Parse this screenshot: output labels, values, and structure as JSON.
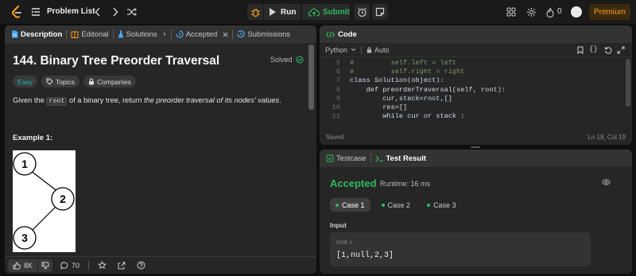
{
  "topbar": {
    "logo_icon": "leetcode-logo",
    "list_icon": "list-icon",
    "problem_list_label": "Problem List",
    "run_label": "Run",
    "submit_label": "Submit",
    "streak_count": "0",
    "premium_label": "Premium",
    "colors": {
      "submit_green": "#2cbb5d",
      "premium_orange": "#ffa116"
    }
  },
  "left_panel": {
    "tabs": [
      {
        "label": "Description",
        "icon": "document-icon"
      },
      {
        "label": "Editorial",
        "icon": "book-icon"
      },
      {
        "label": "Solutions",
        "icon": "flask-icon"
      },
      {
        "label": "Accepted",
        "icon": "clock-icon"
      },
      {
        "label": "Submissions",
        "icon": "history-icon"
      }
    ],
    "problem_title": "144. Binary Tree Preorder Traversal",
    "solved_label": "Solved",
    "tags": {
      "difficulty": "Easy",
      "topics": "Topics",
      "companies": "Companies"
    },
    "desc_prefix": "Given the ",
    "desc_code": "root",
    "desc_middle": " of a binary tree, return ",
    "desc_italic": "the preorder traversal of its nodes' values",
    "desc_suffix": ".",
    "example_heading": "Example 1:",
    "tree_nodes": [
      "1",
      "2",
      "3"
    ],
    "footer": {
      "likes": "8K",
      "comments": "70"
    }
  },
  "code_panel": {
    "title": "Code",
    "language": "Python",
    "auto_label": "Auto",
    "lines": [
      {
        "n": "5",
        "t": "#         self.left = left"
      },
      {
        "n": "6",
        "t": "#         self.right = right"
      },
      {
        "n": "7",
        "t": "class Solution(object):"
      },
      {
        "n": "8",
        "t": "    def preorderTraversal(self, root):"
      },
      {
        "n": "9",
        "t": "        cur,stack=root,[]"
      },
      {
        "n": "10",
        "t": "        res=[]"
      },
      {
        "n": "11",
        "t": "        while cur or stack :"
      }
    ],
    "status": "Saved",
    "cursor": "Ln 18, Col 19"
  },
  "result_panel": {
    "tab_testcase": "Testcase",
    "tab_result": "Test Result",
    "accepted": "Accepted",
    "runtime": "Runtime: 16 ms",
    "cases": [
      "Case 1",
      "Case 2",
      "Case 3"
    ],
    "input_label": "Input",
    "var_name": "root =",
    "var_value": "[1,null,2,3]",
    "colors": {
      "accepted_green": "#2cbb5d"
    }
  }
}
